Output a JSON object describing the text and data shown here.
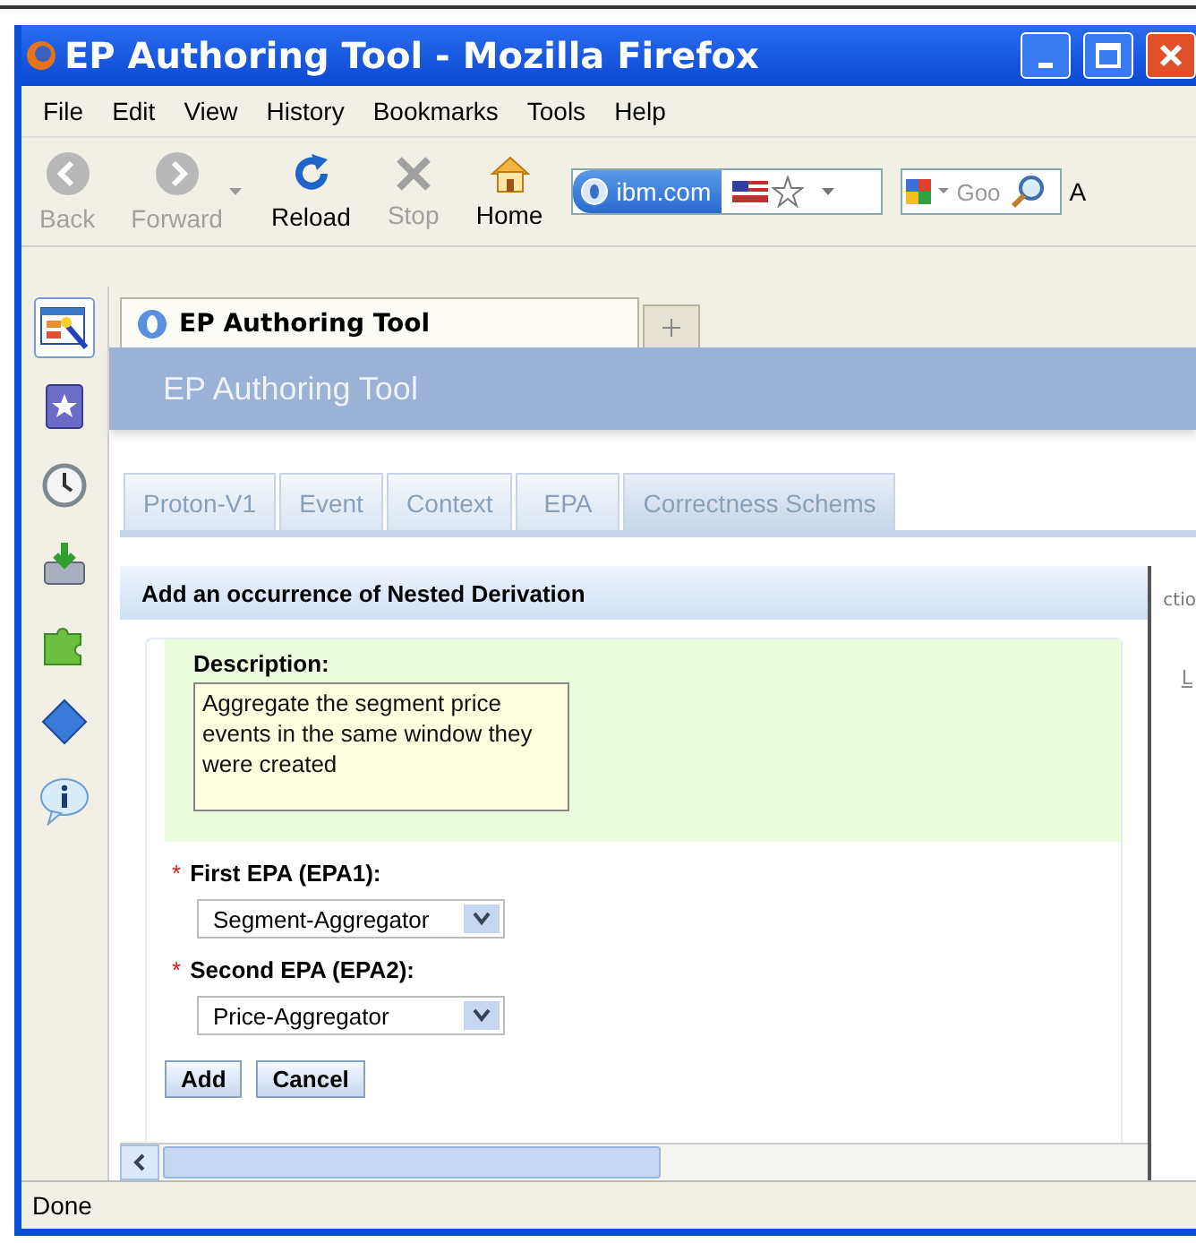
{
  "window": {
    "title": "EP Authoring Tool - Mozilla Firefox"
  },
  "menu": [
    {
      "label": "File"
    },
    {
      "label": "Edit"
    },
    {
      "label": "View"
    },
    {
      "label": "History"
    },
    {
      "label": "Bookmarks"
    },
    {
      "label": "Tools"
    },
    {
      "label": "Help"
    }
  ],
  "toolbar": [
    {
      "kind": "back",
      "label": "Back",
      "disabled": true
    },
    {
      "kind": "forward",
      "label": "Forward",
      "disabled": true
    },
    {
      "kind": "reload",
      "label": "Reload",
      "disabled": false
    },
    {
      "kind": "stop",
      "label": "Stop",
      "disabled": true
    },
    {
      "kind": "home",
      "label": "Home",
      "disabled": false
    }
  ],
  "address": {
    "site": "ibm.com"
  },
  "search": {
    "placeholder": "Goo"
  },
  "toolbar_edge": "A",
  "sidebar": [
    {
      "kind": "editor",
      "selected": true
    },
    {
      "kind": "bookmarks",
      "selected": false
    },
    {
      "kind": "history",
      "selected": false
    },
    {
      "kind": "download",
      "selected": false
    },
    {
      "kind": "addon",
      "selected": false
    },
    {
      "kind": "puzzle",
      "selected": false
    },
    {
      "kind": "info",
      "selected": false
    }
  ],
  "browser_tabs": [
    {
      "label": "EP Authoring Tool",
      "selected": true
    }
  ],
  "app": {
    "header": "EP Authoring Tool",
    "tabs": [
      {
        "label": "Proton-V1",
        "selected": false
      },
      {
        "label": "Event",
        "selected": false
      },
      {
        "label": "Context",
        "selected": false
      },
      {
        "label": "EPA",
        "selected": false
      },
      {
        "label": "Correctness Schems",
        "selected": true
      }
    ],
    "behind_text": "ctio",
    "behind_link": "L"
  },
  "dialog": {
    "title": "Add an occurrence of Nested Derivation",
    "description": {
      "label": "Description:",
      "value": "Aggregate the segment price events in the same window they were created "
    },
    "fields": [
      {
        "label": "First EPA (EPA1):",
        "required_mark": "*",
        "value": "Segment-Aggregator"
      },
      {
        "label": "Second EPA (EPA2):",
        "required_mark": "*",
        "value": "Price-Aggregator"
      }
    ],
    "buttons": [
      "Add",
      "Cancel"
    ]
  },
  "status_bar": "Done"
}
